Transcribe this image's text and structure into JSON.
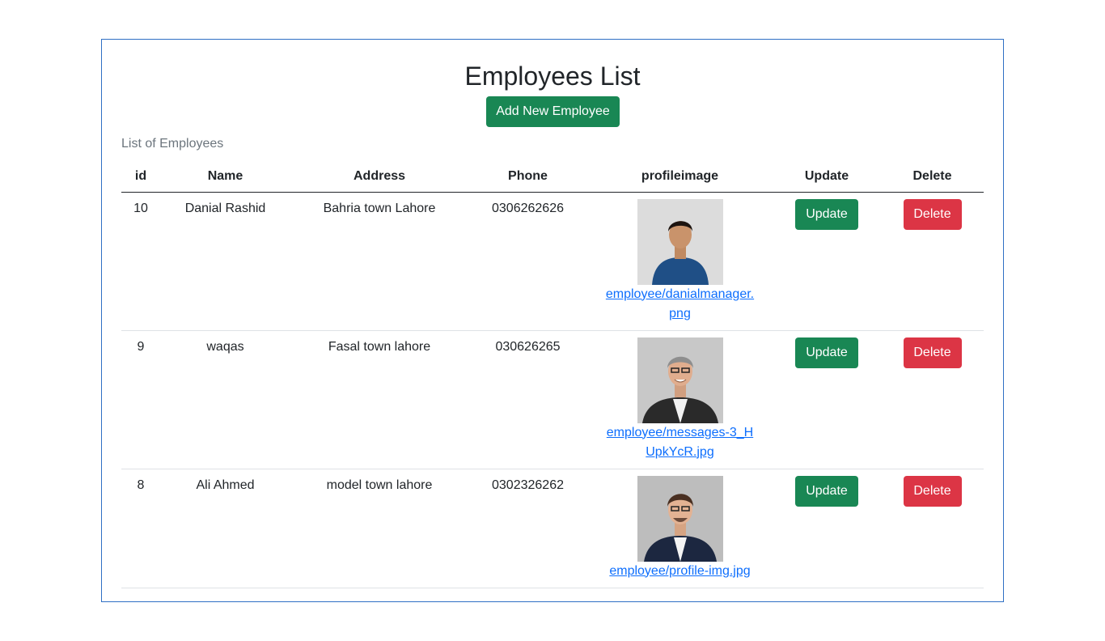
{
  "page": {
    "title": "Employees List",
    "add_button_label": "Add New Employee",
    "caption": "List of Employees"
  },
  "table": {
    "headers": [
      "id",
      "Name",
      "Address",
      "Phone",
      "profileimage",
      "Update",
      "Delete"
    ],
    "rows": [
      {
        "id": "10",
        "name": "Danial Rashid",
        "address": "Bahria town Lahore",
        "phone": "0306262626",
        "image": "employee/danialmanager.png",
        "update": "Update",
        "delete": "Delete"
      },
      {
        "id": "9",
        "name": "waqas",
        "address": "Fasal town lahore",
        "phone": "030626265",
        "image": "employee/messages-3_HUpkYcR.jpg",
        "update": "Update",
        "delete": "Delete"
      },
      {
        "id": "8",
        "name": "Ali Ahmed",
        "address": "model town lahore",
        "phone": "0302326262",
        "image": "employee/profile-img.jpg",
        "update": "Update",
        "delete": "Delete"
      }
    ]
  },
  "colors": {
    "primary_green": "#198754",
    "danger_red": "#dc3545",
    "link_blue": "#0d6efd",
    "card_border": "#2f6fc4"
  }
}
